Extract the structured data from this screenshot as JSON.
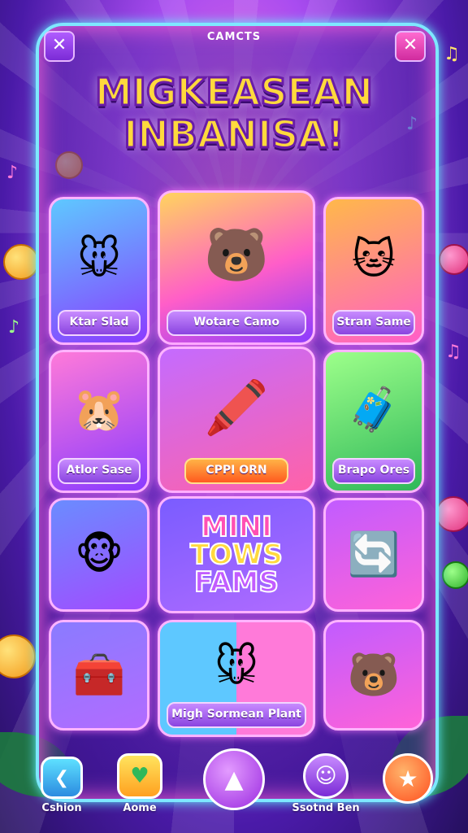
{
  "header": {
    "label": "CAMCTS",
    "close_left": "✕",
    "close_right": "✕",
    "title_line1": "MIGKEASEAN",
    "title_line2": "INBANISA!"
  },
  "grid": {
    "tiles": [
      {
        "label": "Ktar Slad",
        "art": "🐭"
      },
      {
        "label": "Wotare Camo",
        "art": "🐻"
      },
      {
        "label": "Stran Same",
        "art": "🐱"
      },
      {
        "label": "Atlor Sase",
        "art": "🐹"
      },
      {
        "label": "CPPI ORN",
        "art": "🖍️"
      },
      {
        "label": "Brapo Ores",
        "art": "🧳"
      },
      {
        "label": "",
        "art": "🐵"
      },
      {
        "label": "",
        "art": ""
      },
      {
        "label": "",
        "art": "🔄"
      },
      {
        "label": "",
        "art": "🧰"
      },
      {
        "label": "Migh Sormean Plant",
        "art": "🐭"
      },
      {
        "label": "",
        "art": "🐻"
      }
    ],
    "mini_logo": [
      "MINI",
      "TOWS",
      "FAMS"
    ]
  },
  "bottom_nav": [
    {
      "label": "Cshion",
      "icon": "back-arrow-icon",
      "glyph": "❮"
    },
    {
      "label": "Aome",
      "icon": "heart-icon",
      "glyph": "♥"
    },
    {
      "label": "",
      "icon": "play-icon",
      "glyph": "▲"
    },
    {
      "label": "Ssotnd Ben",
      "icon": "profile-icon",
      "glyph": "☺"
    },
    {
      "label": "",
      "icon": "star-icon",
      "glyph": "★"
    }
  ],
  "colors": {
    "frame_border": "#7ee8ff",
    "title_fill": "#ffd93d",
    "title_stroke": "#6a1ca8",
    "tile_border": "#ffb4ff",
    "label_purple": "#8a44e0",
    "label_orange": "#ff5a1f"
  }
}
